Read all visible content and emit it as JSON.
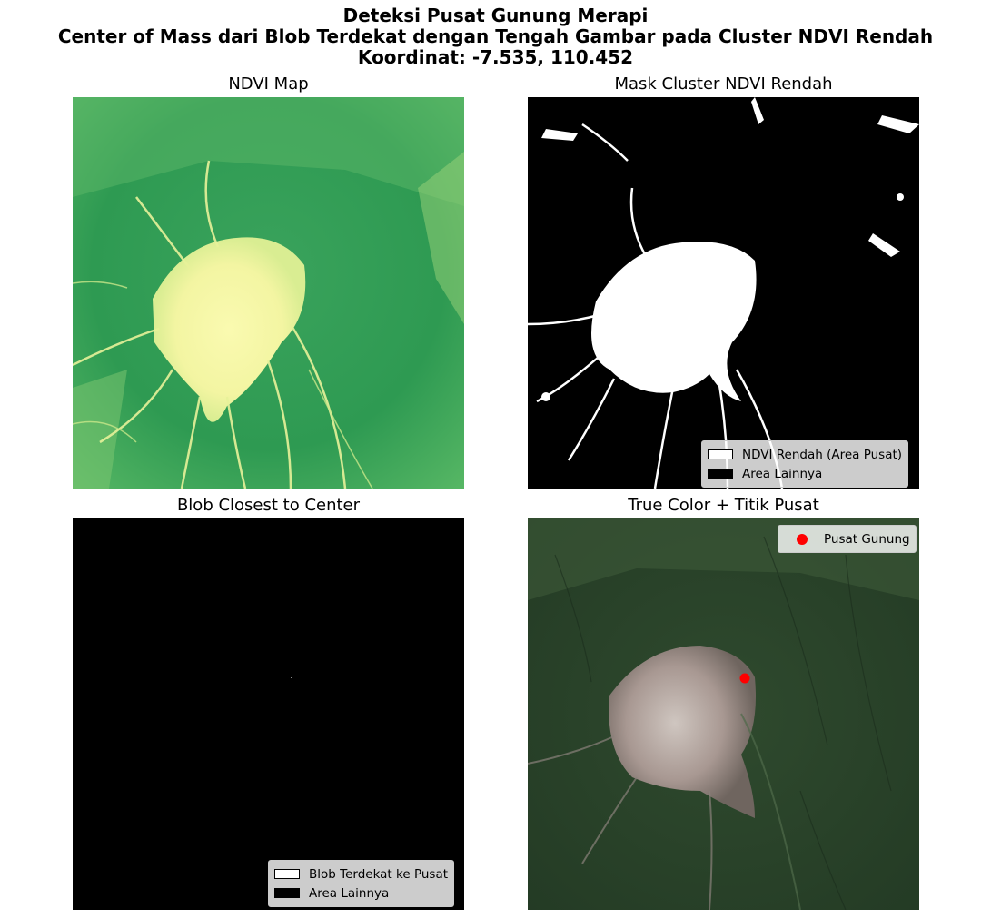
{
  "figure": {
    "title_line1": "Deteksi Pusat Gunung Merapi",
    "title_line2": "Center of Mass dari Blob Terdekat dengan Tengah Gambar pada Cluster NDVI Rendah",
    "title_line3": "Koordinat: -7.535, 110.452"
  },
  "panels": {
    "ndvi": {
      "title": "NDVI Map",
      "colormap": [
        "#1a9850",
        "#91cf60",
        "#fafaa0"
      ]
    },
    "mask": {
      "title": "Mask Cluster NDVI Rendah",
      "legend": [
        {
          "label": "NDVI Rendah (Area Pusat)",
          "color": "#ffffff"
        },
        {
          "label": "Area Lainnya",
          "color": "#000000"
        }
      ]
    },
    "blob": {
      "title": "Blob Closest to Center",
      "legend": [
        {
          "label": "Blob Terdekat ke Pusat",
          "color": "#ffffff"
        },
        {
          "label": "Area Lainnya",
          "color": "#000000"
        }
      ]
    },
    "truecolor": {
      "title": "True Color + Titik Pusat",
      "legend": [
        {
          "label": "Pusat Gunung",
          "color": "#ff0000"
        }
      ]
    }
  }
}
